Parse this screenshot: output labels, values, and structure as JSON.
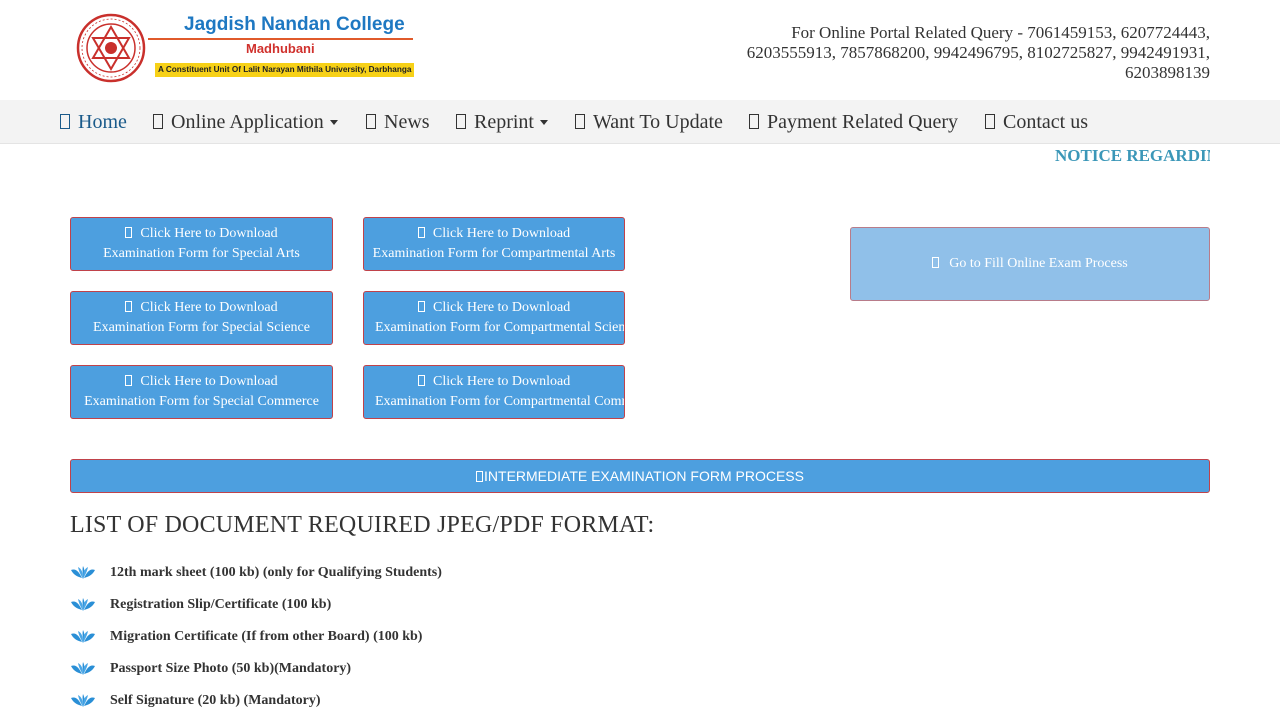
{
  "header": {
    "college_name": "Jagdish Nandan College",
    "college_place": "Madhubani",
    "affiliation": "A Constituent Unit Of Lalit Narayan Mithila University, Darbhanga",
    "contact_lines": [
      "For Online Portal Related Query - 7061459153, 6207724443,",
      "6203555913, 7857868200, 9942496795, 8102725827, 9942491931,",
      "6203898139"
    ]
  },
  "nav": {
    "items": [
      {
        "label": "Home",
        "icon": "home-icon"
      },
      {
        "label": "Online Application",
        "icon": "application-icon",
        "dropdown": true
      },
      {
        "label": "News",
        "icon": "news-icon"
      },
      {
        "label": "Reprint",
        "icon": "print-icon",
        "dropdown": true
      },
      {
        "label": "Want To Update",
        "icon": "edit-icon"
      },
      {
        "label": "Payment Related Query",
        "icon": "payment-icon"
      },
      {
        "label": "Contact us",
        "icon": "contact-icon"
      }
    ]
  },
  "marquee": {
    "text": "NOTICE REGARDING"
  },
  "downloads": [
    {
      "line1": "Click Here to Download",
      "line2": "Examination Form for Special Arts"
    },
    {
      "line1": "Click Here to Download",
      "line2": "Examination Form for Compartmental Arts"
    },
    {
      "line1": "Click Here to Download",
      "line2": "Examination Form for Special Science"
    },
    {
      "line1": "Click Here to Download",
      "line2": "Examination Form for Compartmental Science"
    },
    {
      "line1": "Click Here to Download",
      "line2": "Examination Form for Special Commerce"
    },
    {
      "line1": "Click Here to Download",
      "line2": "Examination Form for Compartmental Commerce"
    }
  ],
  "fill_button": {
    "label": "Go to Fill Online Exam Process"
  },
  "intermediate_button": {
    "label": "INTERMEDIATE EXAMINATION FORM PROCESS"
  },
  "documents": {
    "heading": "LIST OF DOCUMENT REQUIRED JPEG/PDF FORMAT:",
    "items": [
      "12th mark sheet (100 kb) (only for Qualifying Students)",
      "Registration Slip/Certificate (100 kb)",
      "Migration Certificate (If from other Board) (100 kb)",
      "Passport Size Photo (50 kb)(Mandatory)",
      "Self Signature (20 kb) (Mandatory)"
    ]
  },
  "colors": {
    "button_blue": "#4d9fdf",
    "button_light": "#90c0e9",
    "brand_blue": "#1e78c2",
    "marquee_teal": "#3b97b8"
  }
}
